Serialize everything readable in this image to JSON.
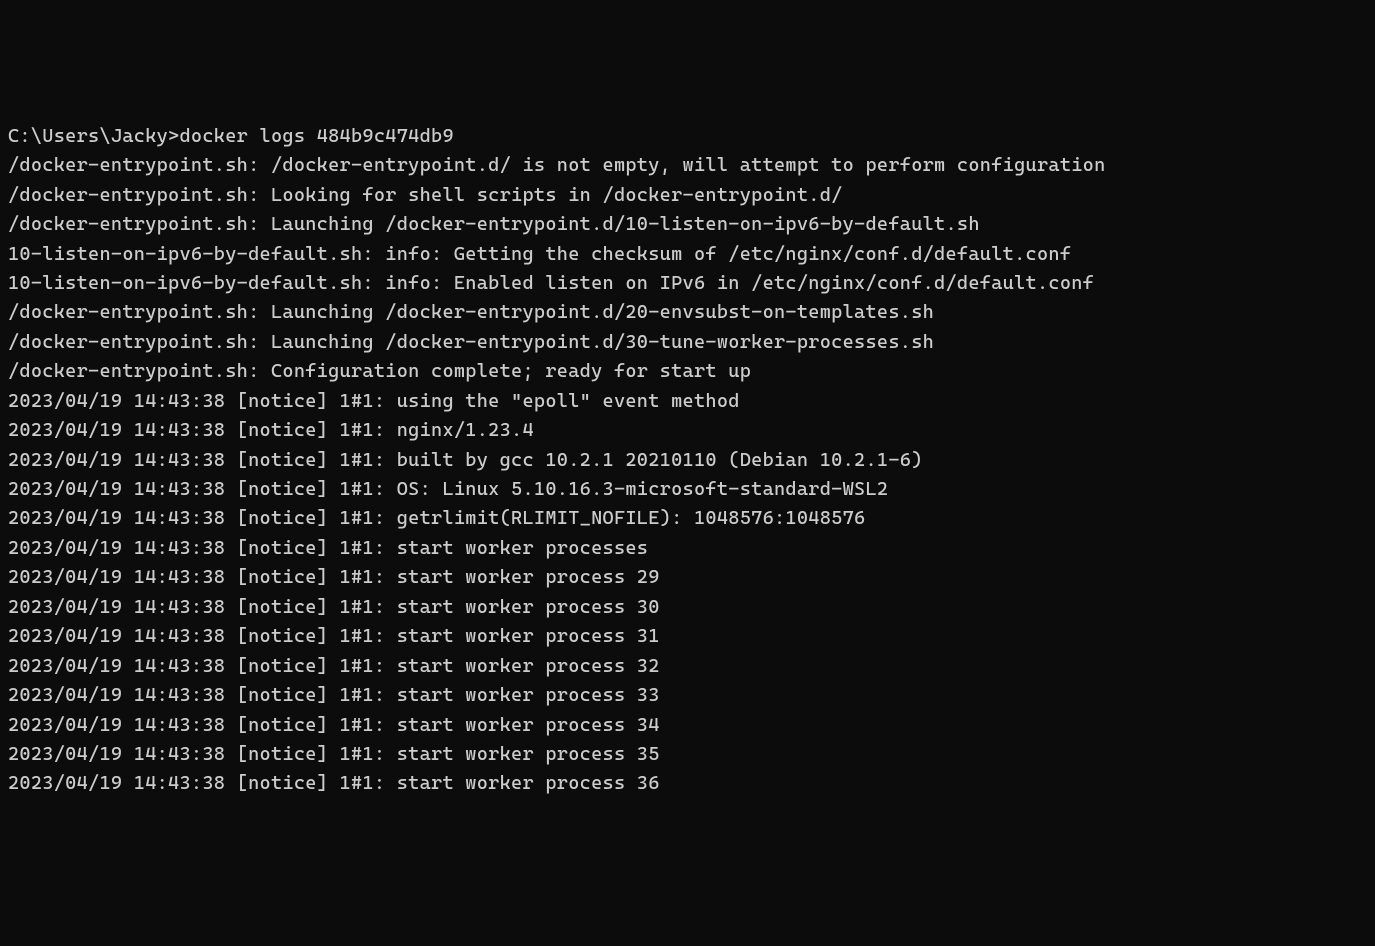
{
  "terminal": {
    "prompt": "C:\\Users\\Jacky>",
    "command": "docker logs 484b9c474db9",
    "lines": [
      "/docker-entrypoint.sh: /docker-entrypoint.d/ is not empty, will attempt to perform configuration",
      "/docker-entrypoint.sh: Looking for shell scripts in /docker-entrypoint.d/",
      "/docker-entrypoint.sh: Launching /docker-entrypoint.d/10-listen-on-ipv6-by-default.sh",
      "10-listen-on-ipv6-by-default.sh: info: Getting the checksum of /etc/nginx/conf.d/default.conf",
      "10-listen-on-ipv6-by-default.sh: info: Enabled listen on IPv6 in /etc/nginx/conf.d/default.conf",
      "/docker-entrypoint.sh: Launching /docker-entrypoint.d/20-envsubst-on-templates.sh",
      "/docker-entrypoint.sh: Launching /docker-entrypoint.d/30-tune-worker-processes.sh",
      "/docker-entrypoint.sh: Configuration complete; ready for start up",
      "2023/04/19 14:43:38 [notice] 1#1: using the \"epoll\" event method",
      "2023/04/19 14:43:38 [notice] 1#1: nginx/1.23.4",
      "2023/04/19 14:43:38 [notice] 1#1: built by gcc 10.2.1 20210110 (Debian 10.2.1-6)",
      "2023/04/19 14:43:38 [notice] 1#1: OS: Linux 5.10.16.3-microsoft-standard-WSL2",
      "2023/04/19 14:43:38 [notice] 1#1: getrlimit(RLIMIT_NOFILE): 1048576:1048576",
      "2023/04/19 14:43:38 [notice] 1#1: start worker processes",
      "2023/04/19 14:43:38 [notice] 1#1: start worker process 29",
      "2023/04/19 14:43:38 [notice] 1#1: start worker process 30",
      "2023/04/19 14:43:38 [notice] 1#1: start worker process 31",
      "2023/04/19 14:43:38 [notice] 1#1: start worker process 32",
      "2023/04/19 14:43:38 [notice] 1#1: start worker process 33",
      "2023/04/19 14:43:38 [notice] 1#1: start worker process 34",
      "2023/04/19 14:43:38 [notice] 1#1: start worker process 35",
      "2023/04/19 14:43:38 [notice] 1#1: start worker process 36"
    ]
  }
}
